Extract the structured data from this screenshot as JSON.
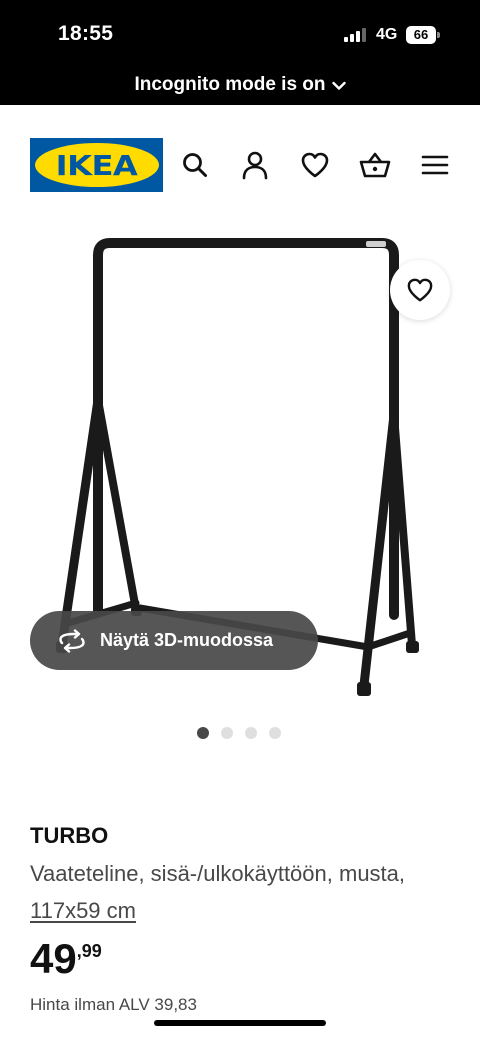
{
  "status_bar": {
    "time": "18:55",
    "network": "4G",
    "battery": "66"
  },
  "browser": {
    "incognito_text": "Incognito mode is on"
  },
  "header": {
    "logo_text": "IKEA",
    "icons": [
      "search-icon",
      "account-icon",
      "favourites-icon",
      "shopping-basket-icon",
      "menu-icon"
    ]
  },
  "gallery": {
    "view_3d_label": "Näytä 3D-muodossa",
    "image_count": 4,
    "active_index": 0
  },
  "product": {
    "name": "TURBO",
    "description": "Vaateteline, sisä-/ulkokäyttöön, musta,",
    "dimensions": "117x59 cm",
    "price_integer": "49",
    "price_decimal": ",99",
    "price_excl_vat": "Hinta ilman ALV 39,83"
  },
  "colors": {
    "ikea_blue": "#0058a3",
    "ikea_yellow": "#ffdb00",
    "text_primary": "#111111",
    "text_secondary": "#484848"
  }
}
